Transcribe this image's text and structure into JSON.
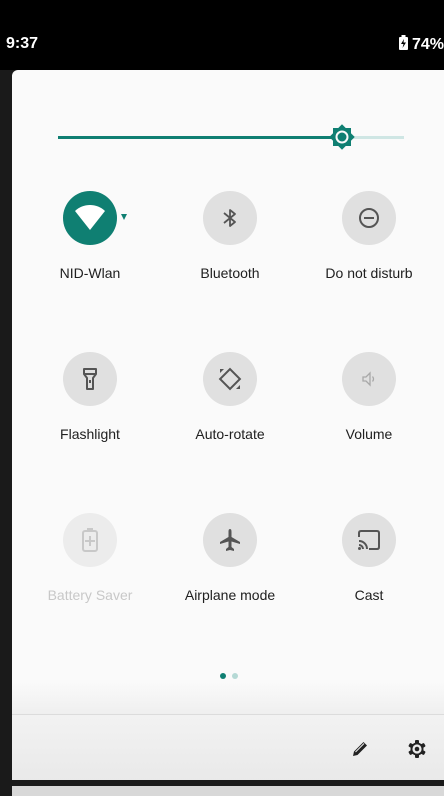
{
  "status_bar": {
    "time": "9:37",
    "battery_percent": "74%"
  },
  "brightness": {
    "level": 0.82
  },
  "tiles": [
    {
      "label": "NID-Wlan",
      "icon": "wifi-icon",
      "state": "active",
      "has_dropdown": true
    },
    {
      "label": "Bluetooth",
      "icon": "bluetooth-icon",
      "state": "off"
    },
    {
      "label": "Do not disturb",
      "icon": "do-not-disturb-icon",
      "state": "off"
    },
    {
      "label": "Flashlight",
      "icon": "flashlight-icon",
      "state": "off"
    },
    {
      "label": "Auto-rotate",
      "icon": "auto-rotate-icon",
      "state": "off"
    },
    {
      "label": "Volume",
      "icon": "volume-icon",
      "state": "off"
    },
    {
      "label": "Battery Saver",
      "icon": "battery-saver-icon",
      "state": "disabled"
    },
    {
      "label": "Airplane mode",
      "icon": "airplane-icon",
      "state": "off"
    },
    {
      "label": "Cast",
      "icon": "cast-icon",
      "state": "off"
    }
  ],
  "pager": {
    "pages": 2,
    "current": 1
  },
  "footer": {
    "edit_icon": "pencil-icon",
    "settings_icon": "gear-icon"
  },
  "colors": {
    "accent": "#0f7f72",
    "tile_off": "#e0e0e0",
    "track": "#cfe6e4",
    "dot_inactive": "#b5d9d5"
  }
}
